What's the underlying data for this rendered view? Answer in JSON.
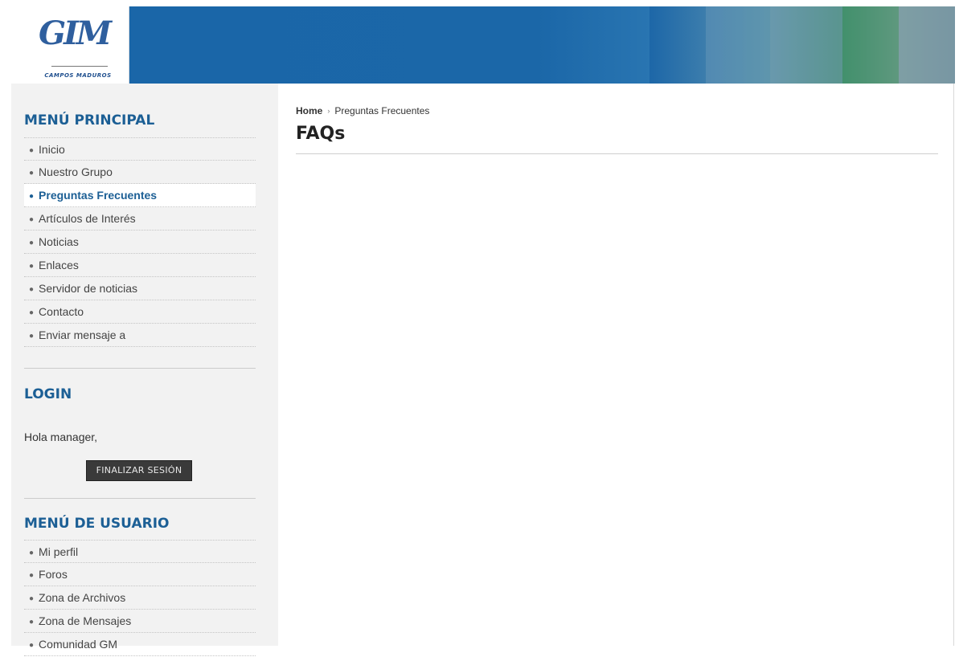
{
  "header": {
    "logo_mark": "GIM",
    "logo_caption": "CAMPOS MADUROS",
    "colors": {
      "banner": "#1b67a8"
    }
  },
  "sidebar": {
    "main_menu": {
      "title": "MENÚ PRINCIPAL",
      "items": [
        {
          "label": "Inicio"
        },
        {
          "label": "Nuestro Grupo"
        },
        {
          "label": "Preguntas Frecuentes",
          "active": true
        },
        {
          "label": "Artículos de Interés"
        },
        {
          "label": "Noticias"
        },
        {
          "label": "Enlaces"
        },
        {
          "label": "Servidor de noticias"
        },
        {
          "label": "Contacto"
        },
        {
          "label": "Enviar mensaje a"
        }
      ]
    },
    "login": {
      "title": "LOGIN",
      "greeting": "Hola manager,",
      "logout_label": "FINALIZAR SESIÓN"
    },
    "user_menu": {
      "title": "MENÚ DE USUARIO",
      "items": [
        {
          "label": "Mi perfil"
        },
        {
          "label": "Foros"
        },
        {
          "label": "Zona de Archivos"
        },
        {
          "label": "Zona de Mensajes"
        },
        {
          "label": "Comunidad GM"
        }
      ]
    },
    "colors": {
      "title": "#1c5f95",
      "background": "#f2f2f2"
    }
  },
  "main": {
    "breadcrumb": {
      "home": "Home",
      "separator": "›",
      "current": "Preguntas Frecuentes"
    },
    "title": "FAQs"
  }
}
